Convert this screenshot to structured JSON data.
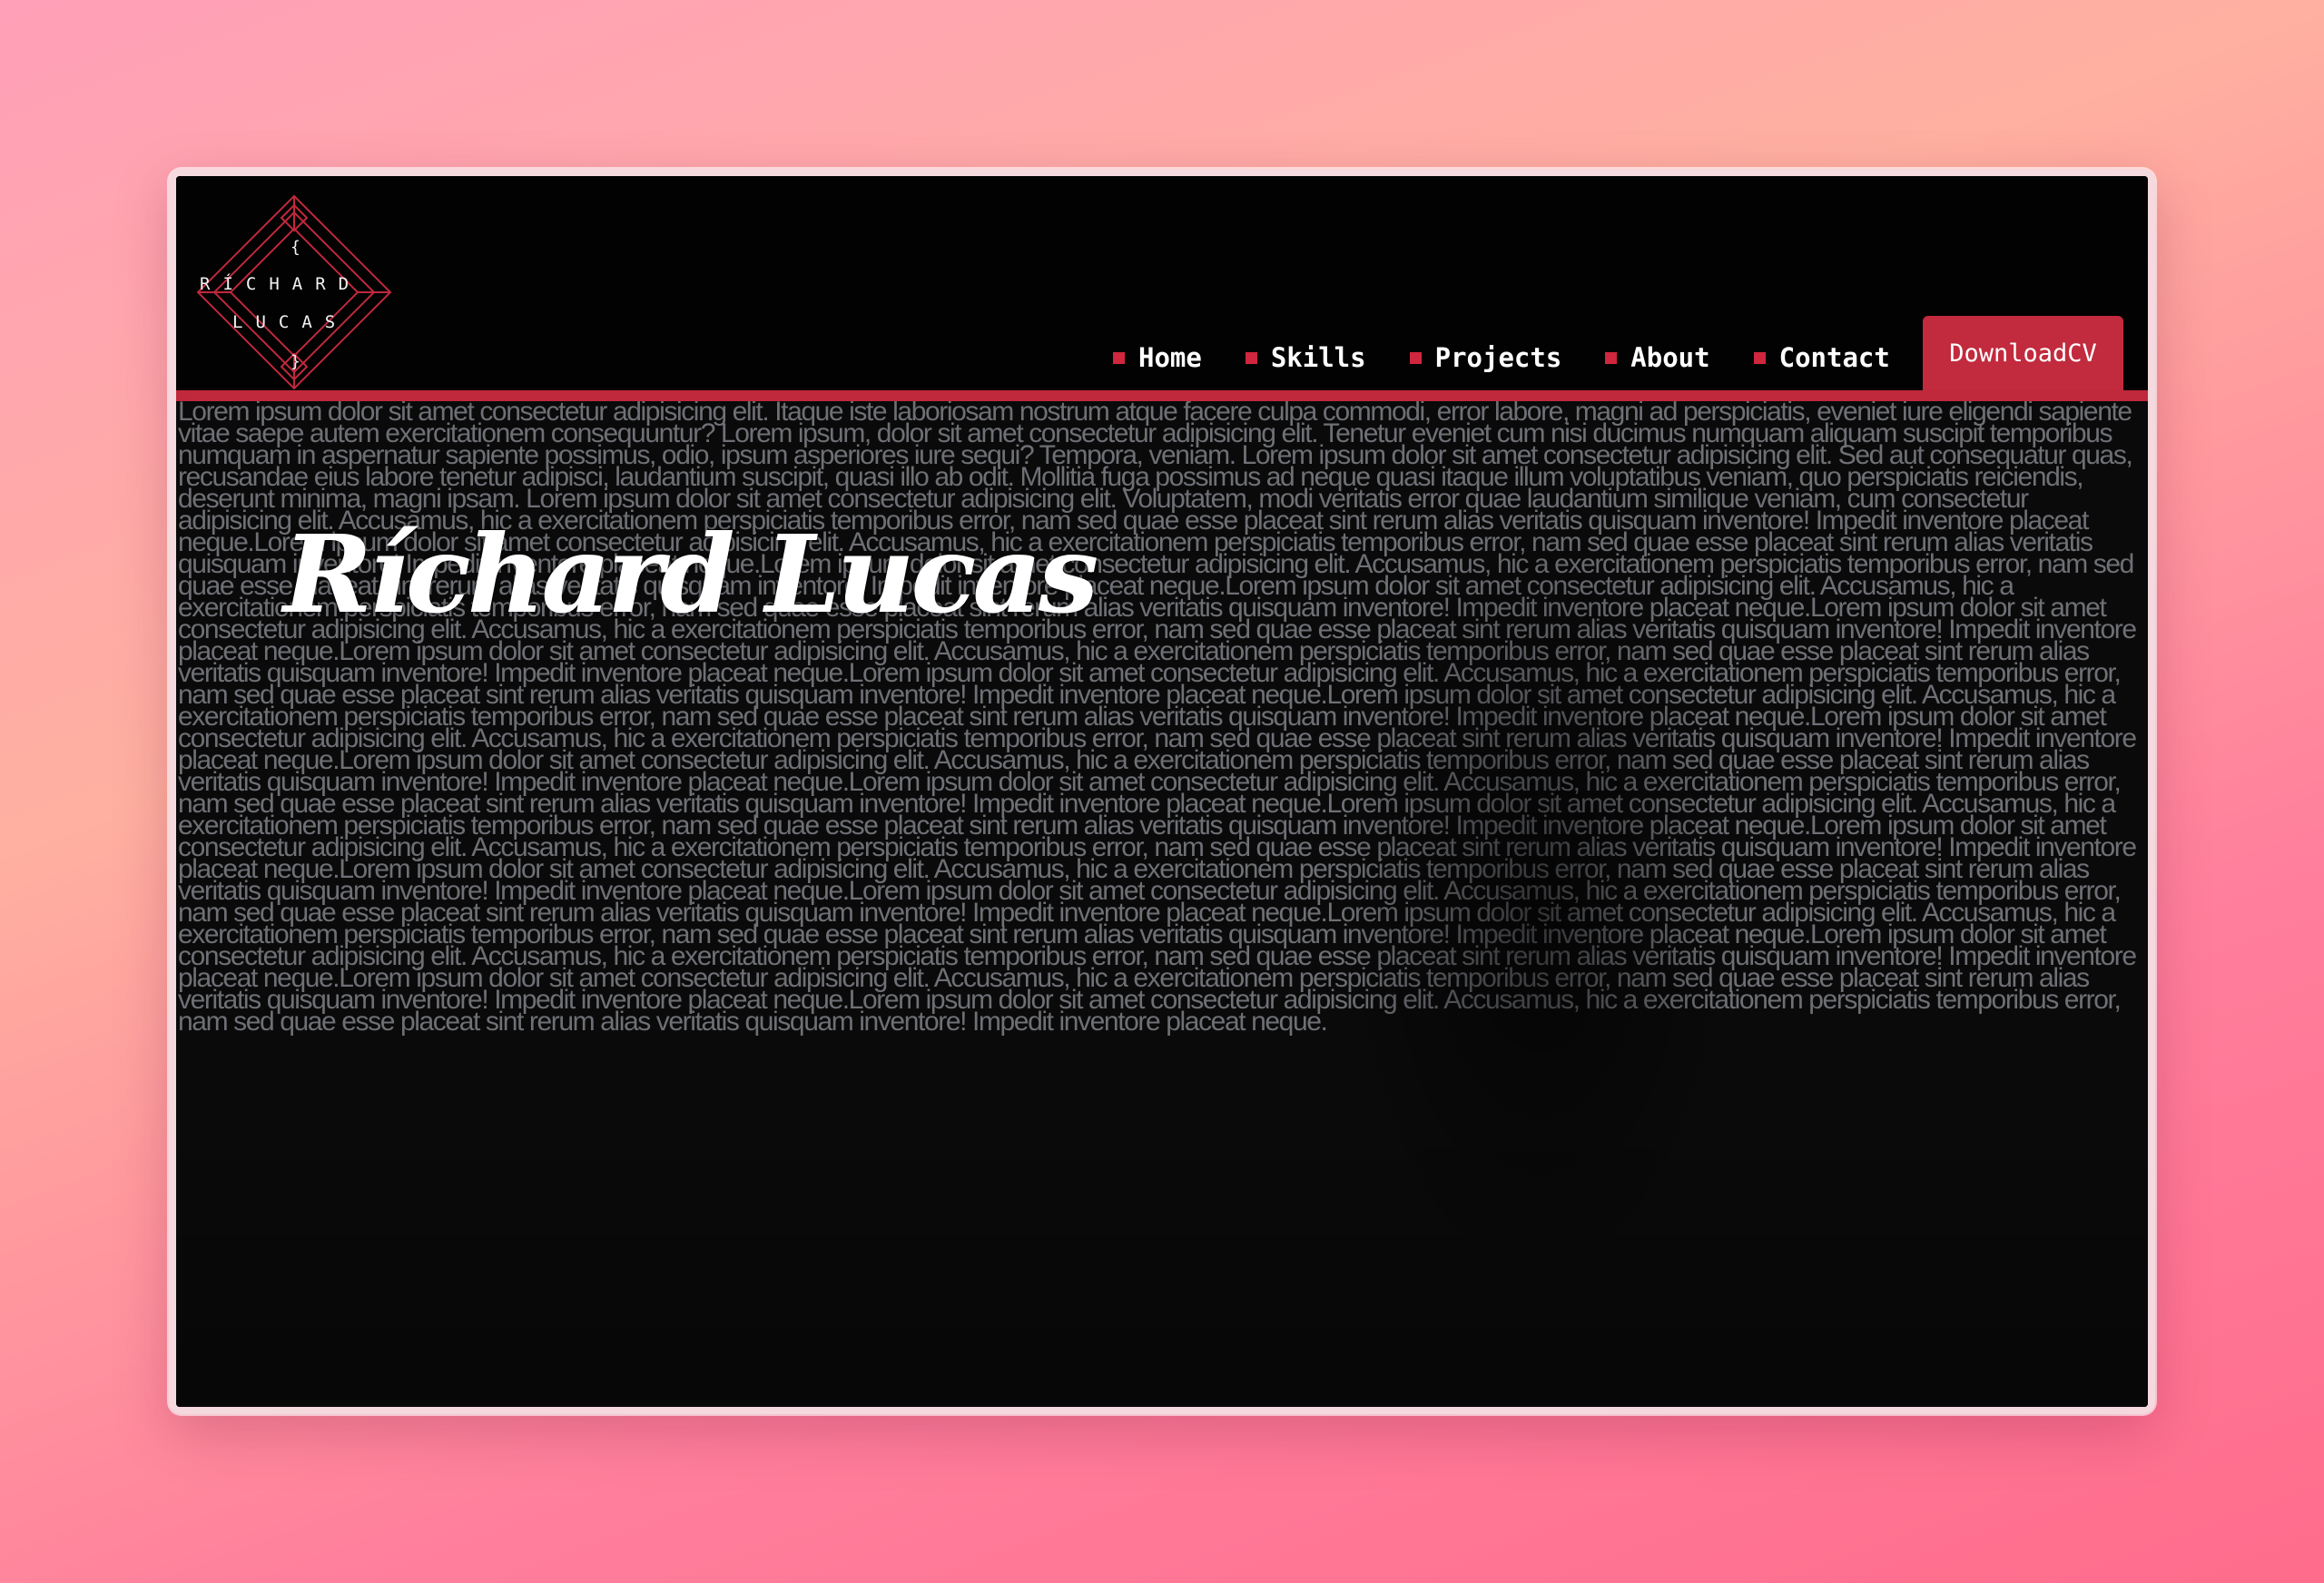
{
  "logo": {
    "top_brace": "{",
    "line1": "RÍCHARD",
    "line2": "LUCAS",
    "bottom_brace": "}",
    "icon": "diamond-monogram-icon",
    "accent_color": "#c0283c"
  },
  "nav": {
    "items": [
      {
        "label": "Home"
      },
      {
        "label": "Skills"
      },
      {
        "label": "Projects"
      },
      {
        "label": "About"
      },
      {
        "label": "Contact"
      }
    ],
    "bullet_color": "#d0263e"
  },
  "download_cv": {
    "label": "DownloadCV",
    "color": "#c22a3e"
  },
  "hero": {
    "name": "Ríchard Lucas",
    "background_text_first": "Lorem ipsum dolor sit amet consectetur adipisicing elit. Itaque iste laboriosam nostrum atque facere culpa commodi, error labore, magni ad perspiciatis, eveniet iure eligendi sapiente vitae saepe autem exercitationem consequuntur? Lorem ipsum, dolor sit amet consectetur adipisicing elit. Tenetur eveniet cum nisi ducimus numquam aliquam suscipit temporibus numquam in aspernatur sapiente possimus, odio, ipsum asperiores iure sequi? Tempora, veniam. Lorem ipsum dolor sit amet consectetur adipisicing elit. Sed aut consequatur quas, recusandae eius labore tenetur adipisci, laudantium suscipit, quasi illo ab odit. Mollitia fuga possimus ad neque quasi itaque illum voluptatibus veniam, quo perspiciatis reiciendis, deserunt minima, magni ipsam. Lorem ipsum dolor sit amet consectetur adipisicing elit. Voluptatem, modi veritatis error quae laudantium similique veniam, cum consectetur adipisicing elit. Accusamus, hic a exercitationem perspiciatis temporibus error, nam sed quae esse placeat sint rerum alias veritatis quisquam inventore! Impedit inventore placeat neque.",
    "background_text_repeat": "Lorem ipsum dolor sit amet consectetur adipisicing elit. Accusamus, hic a exercitationem perspiciatis temporibus error, nam sed quae esse placeat sint rerum alias veritatis quisquam inventore! Impedit inventore placeat neque.",
    "text_color": "#6e7075"
  }
}
